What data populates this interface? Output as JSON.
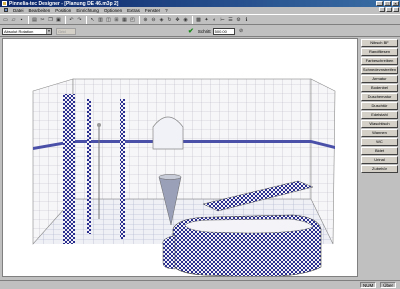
{
  "window": {
    "title": "Pinnelia-tec Designer - [Planung DE 46.m3p 2]"
  },
  "menu": [
    "Datei",
    "Bearbeiten",
    "Position",
    "Einrichtung",
    "Optionen",
    "Extras",
    "Fenster",
    "?"
  ],
  "toolbar2": {
    "rotation_select": "Absolut Rotation",
    "disabled_field": "Grid",
    "step_label": "Schritt",
    "step_value": "500.00"
  },
  "panel_items": [
    "Nibsch BF",
    "Randfliesen",
    "Farbeschreiben",
    "Schnedevnstreifen",
    "Armatur",
    "Bodenbel",
    "Duschematur",
    "Duschtür",
    "Edelstahl",
    "Waschtisch",
    "Wannen",
    "WC",
    "Bidet",
    "Urinal",
    "Zubehör"
  ],
  "status": {
    "mode": "NUM",
    "flag": "Über"
  },
  "colors": {
    "tile_check": "#2a2f8f",
    "stripe": "#4a4fa8",
    "title_start": "#0a246a"
  }
}
